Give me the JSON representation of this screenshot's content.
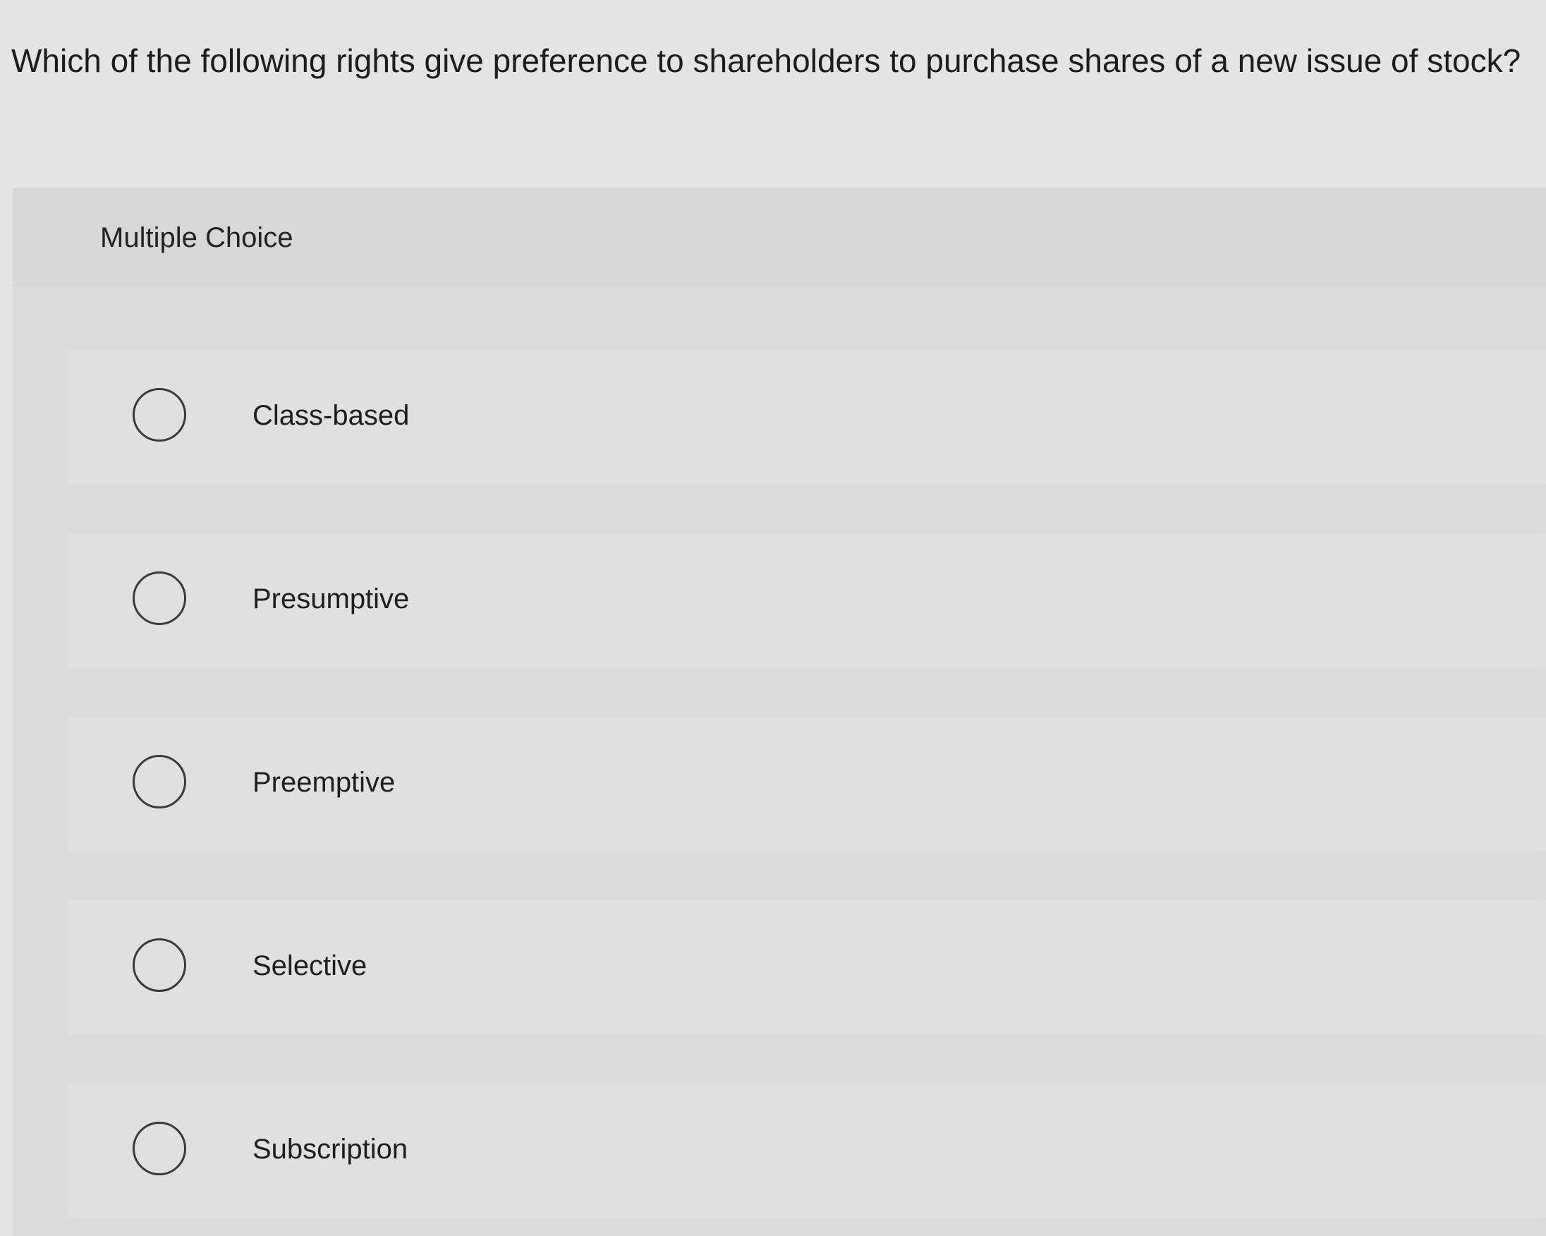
{
  "question": {
    "text": "Which of the following rights give preference to shareholders to purchase shares of a new issue of stock?"
  },
  "panel": {
    "title": "Multiple Choice"
  },
  "options": [
    {
      "label": "Class-based",
      "icon": "radio-unselected-icon",
      "selected": false
    },
    {
      "label": "Presumptive",
      "icon": "radio-unselected-icon",
      "selected": false
    },
    {
      "label": "Preemptive",
      "icon": "radio-unselected-icon",
      "selected": false
    },
    {
      "label": "Selective",
      "icon": "radio-unselected-icon",
      "selected": false
    },
    {
      "label": "Subscription",
      "icon": "radio-unselected-icon",
      "selected": false
    }
  ]
}
